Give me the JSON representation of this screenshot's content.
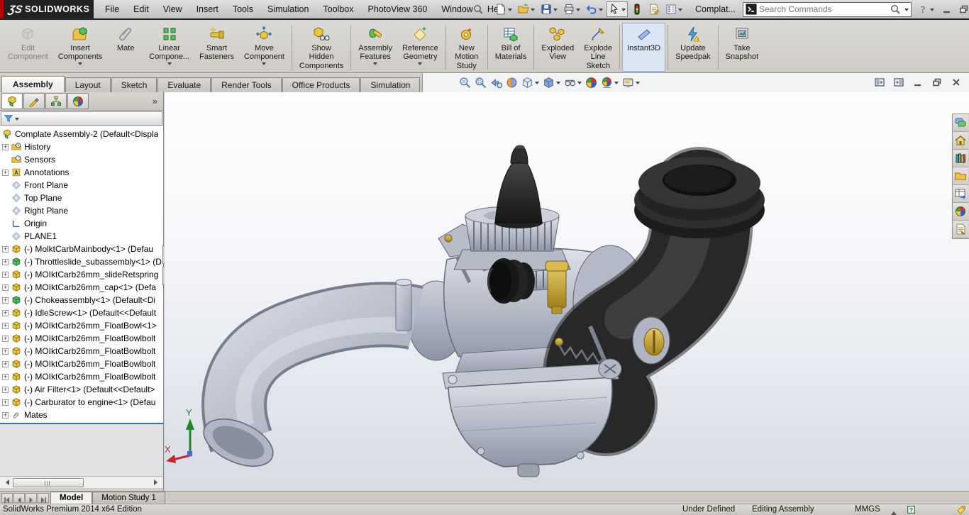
{
  "window": {
    "logo_glyph": "ƷS",
    "logo_text": "SOLIDWORKS",
    "doc_title": "Complat...",
    "search_placeholder": "Search Commands"
  },
  "menu_bar": {
    "items": [
      "File",
      "Edit",
      "View",
      "Insert",
      "Tools",
      "Simulation",
      "Toolbox",
      "PhotoView 360",
      "Window",
      "Help"
    ]
  },
  "quick_access": {
    "items": [
      {
        "icon": "new-doc",
        "dd": true
      },
      {
        "icon": "open-folder",
        "dd": true
      },
      {
        "icon": "save",
        "dd": true
      },
      {
        "icon": "print",
        "dd": true
      },
      {
        "icon": "undo",
        "dd": true
      },
      {
        "icon": "select-cursor",
        "dd": true,
        "pressed": true
      },
      {
        "icon": "rebuild"
      },
      {
        "icon": "file-properties"
      },
      {
        "icon": "options",
        "dd": true
      }
    ]
  },
  "ribbon": {
    "items": [
      {
        "icon": "edit-component",
        "label": "Edit\nComponent",
        "disabled": true
      },
      {
        "icon": "insert-components",
        "label": "Insert\nComponents",
        "dd": true
      },
      {
        "icon": "mate",
        "label": "Mate"
      },
      {
        "icon": "linear-pattern",
        "label": "Linear\nCompone...",
        "dd": true
      },
      {
        "icon": "smart-fasteners",
        "label": "Smart\nFasteners"
      },
      {
        "icon": "move-component",
        "label": "Move\nComponent",
        "dd": true
      },
      {
        "sep": true
      },
      {
        "icon": "show-hidden",
        "label": "Show\nHidden\nComponents"
      },
      {
        "sep": true
      },
      {
        "icon": "assembly-features",
        "label": "Assembly\nFeatures",
        "dd": true
      },
      {
        "icon": "reference-geometry",
        "label": "Reference\nGeometry",
        "dd": true
      },
      {
        "sep": true
      },
      {
        "icon": "new-motion-study",
        "label": "New\nMotion\nStudy"
      },
      {
        "sep": true
      },
      {
        "icon": "bill-of-materials",
        "label": "Bill of\nMaterials"
      },
      {
        "sep": true
      },
      {
        "icon": "exploded-view",
        "label": "Exploded\nView"
      },
      {
        "icon": "explode-line-sketch",
        "label": "Explode\nLine\nSketch"
      },
      {
        "sep": true
      },
      {
        "icon": "instant3d",
        "label": "Instant3D",
        "active": true
      },
      {
        "sep": true
      },
      {
        "icon": "update-speedpak",
        "label": "Update\nSpeedpak"
      },
      {
        "sep": true
      },
      {
        "icon": "take-snapshot",
        "label": "Take\nSnapshot"
      }
    ]
  },
  "ribbon_tabs": {
    "active": 0,
    "items": [
      "Assembly",
      "Layout",
      "Sketch",
      "Evaluate",
      "Render Tools",
      "Office Products",
      "Simulation"
    ]
  },
  "headsup": {
    "items": [
      {
        "icon": "zoom-fit"
      },
      {
        "icon": "zoom-area"
      },
      {
        "icon": "previous-view"
      },
      {
        "icon": "section-view"
      },
      {
        "icon": "view-orientation",
        "dd": true
      },
      {
        "icon": "display-style",
        "dd": true
      },
      {
        "icon": "hide-show-items",
        "dd": true
      },
      {
        "icon": "edit-appearance"
      },
      {
        "icon": "apply-scene",
        "dd": true
      },
      {
        "icon": "view-settings",
        "dd": true
      }
    ]
  },
  "feature_panel": {
    "tabs": [
      {
        "icon": "fm-assembly",
        "active": true
      },
      {
        "icon": "fm-property"
      },
      {
        "icon": "fm-config"
      },
      {
        "icon": "fm-display"
      }
    ],
    "overflow": "»",
    "root_label": "Complate Assembly-2  (Default<Displa",
    "items": [
      {
        "icon": "history",
        "label": "History",
        "expand": true
      },
      {
        "icon": "sensors",
        "label": "Sensors"
      },
      {
        "icon": "annotations",
        "label": "Annotations",
        "expand": true
      },
      {
        "icon": "plane",
        "label": "Front Plane"
      },
      {
        "icon": "plane",
        "label": "Top Plane"
      },
      {
        "icon": "plane",
        "label": "Right Plane"
      },
      {
        "icon": "origin",
        "label": "Origin"
      },
      {
        "icon": "plane",
        "label": "PLANE1"
      },
      {
        "icon": "part",
        "label": "(-) MolktCarbMainbody<1> (Defau",
        "expand": true
      },
      {
        "icon": "subassembly",
        "label": "(-) Throttleslide_subassembly<1> (D",
        "expand": true
      },
      {
        "icon": "part",
        "label": "(-) MOIktCarb26mm_slideRetspring",
        "expand": true
      },
      {
        "icon": "part",
        "label": "(-) MOIktCarb26mm_cap<1> (Defa",
        "expand": true
      },
      {
        "icon": "subassembly",
        "label": "(-) Chokeassembly<1> (Default<Di",
        "expand": true
      },
      {
        "icon": "part",
        "label": "(-) IdleScrew<1> (Default<<Default",
        "expand": true
      },
      {
        "icon": "part",
        "label": "(-) MOIktCarb26mm_FloatBowl<1>",
        "expand": true
      },
      {
        "icon": "part",
        "label": "(-) MOIktCarb26mm_FloatBowlbolt",
        "expand": true
      },
      {
        "icon": "part",
        "label": "(-) MOIktCarb26mm_FloatBowlbolt",
        "expand": true
      },
      {
        "icon": "part",
        "label": "(-) MOIktCarb26mm_FloatBowlbolt",
        "expand": true
      },
      {
        "icon": "part",
        "label": "(-) MOIktCarb26mm_FloatBowlbolt",
        "expand": true
      },
      {
        "icon": "part",
        "label": "(-) Air Filter<1> (Default<<Default>",
        "expand": true
      },
      {
        "icon": "part",
        "label": "(-) Carburator to engine<1> (Defau",
        "expand": true
      },
      {
        "icon": "mates",
        "label": "Mates",
        "expand": true
      }
    ]
  },
  "task_pane": {
    "items": [
      {
        "icon": "comments"
      },
      {
        "icon": "resources-home"
      },
      {
        "icon": "design-library"
      },
      {
        "icon": "file-explorer"
      },
      {
        "icon": "view-palette"
      },
      {
        "icon": "appearances"
      },
      {
        "icon": "custom-properties"
      }
    ]
  },
  "viewport": {
    "triad": {
      "x_label": "X",
      "y_label": "Y"
    }
  },
  "model_tabs": {
    "nav_icons": [
      "nav-first",
      "nav-prev",
      "nav-next",
      "nav-last"
    ],
    "items": [
      {
        "label": "Model",
        "active": true
      },
      {
        "label": "Motion Study 1"
      }
    ]
  },
  "status_bar": {
    "app": "SolidWorks Premium 2014 x64 Edition",
    "state": "Under Defined",
    "mode": "Editing Assembly",
    "units": "MMGS"
  },
  "icons": {
    "menu_search": "magnifier",
    "filter": "filter-funnel",
    "search_box_left": "search-terminal",
    "search_box_magnifier": "magnifier",
    "help": "help-circle",
    "win_min": "win-min",
    "win_restore": "win-restore",
    "win_close": "win-close",
    "pane_left": "pane-left",
    "pane_right": "pane-right",
    "doc_min": "win-min",
    "doc_restore": "win-restore",
    "doc_close": "win-close",
    "status_help": "status-help",
    "status_tag": "status-tag"
  },
  "colors": {
    "accent_blue": "#2a6dd8",
    "part_yellow": "#e9c63c",
    "assembly_green": "#56c05e",
    "brass": "#c9a83a",
    "rubber_black": "#282828",
    "metal_gray": "#aeb4c2"
  }
}
